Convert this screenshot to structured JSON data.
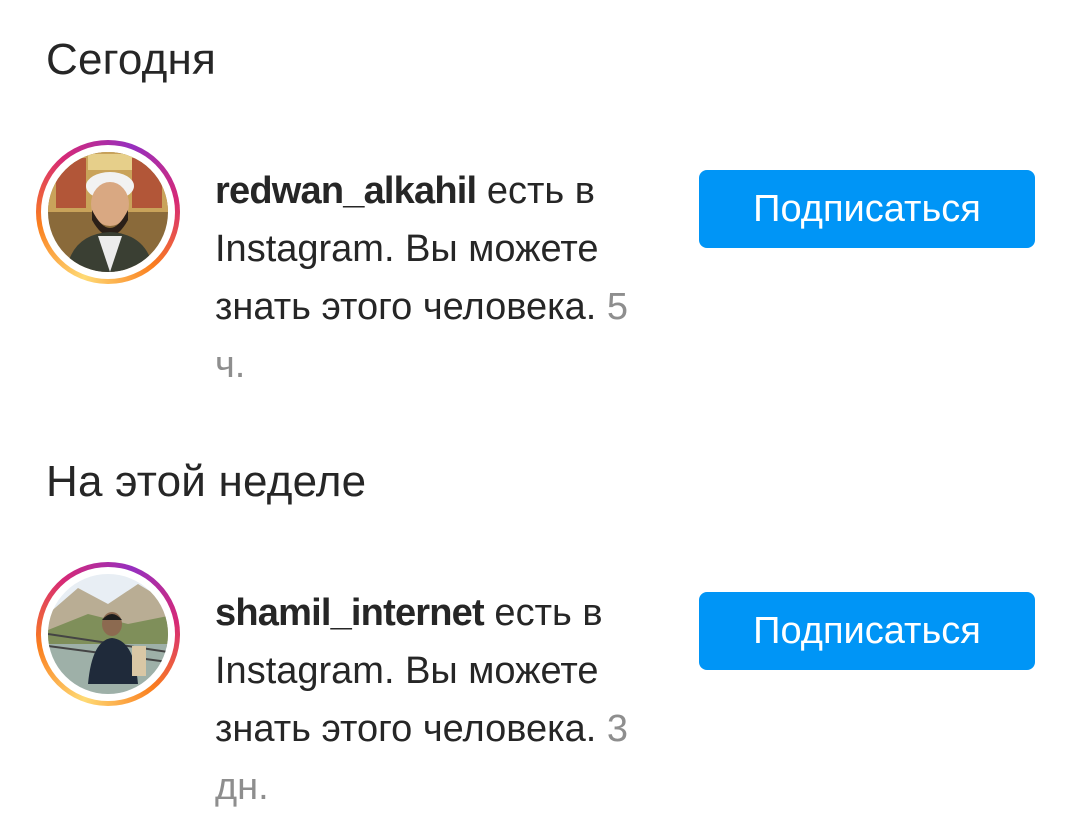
{
  "sections": [
    {
      "title": "Сегодня",
      "item": {
        "username": "redwan_alkahil",
        "message": " есть в Instagram. Вы можете знать этого человека.",
        "time": "5 ч.",
        "button_label": "Подписаться"
      }
    },
    {
      "title": "На этой неделе",
      "item": {
        "username": "shamil_internet",
        "message": " есть в Instagram. Вы можете знать этого человека.",
        "time": "3 дн.",
        "button_label": "Подписаться"
      }
    }
  ],
  "colors": {
    "accent": "#0095f6",
    "text": "#262626",
    "muted": "#8e8e8e"
  }
}
